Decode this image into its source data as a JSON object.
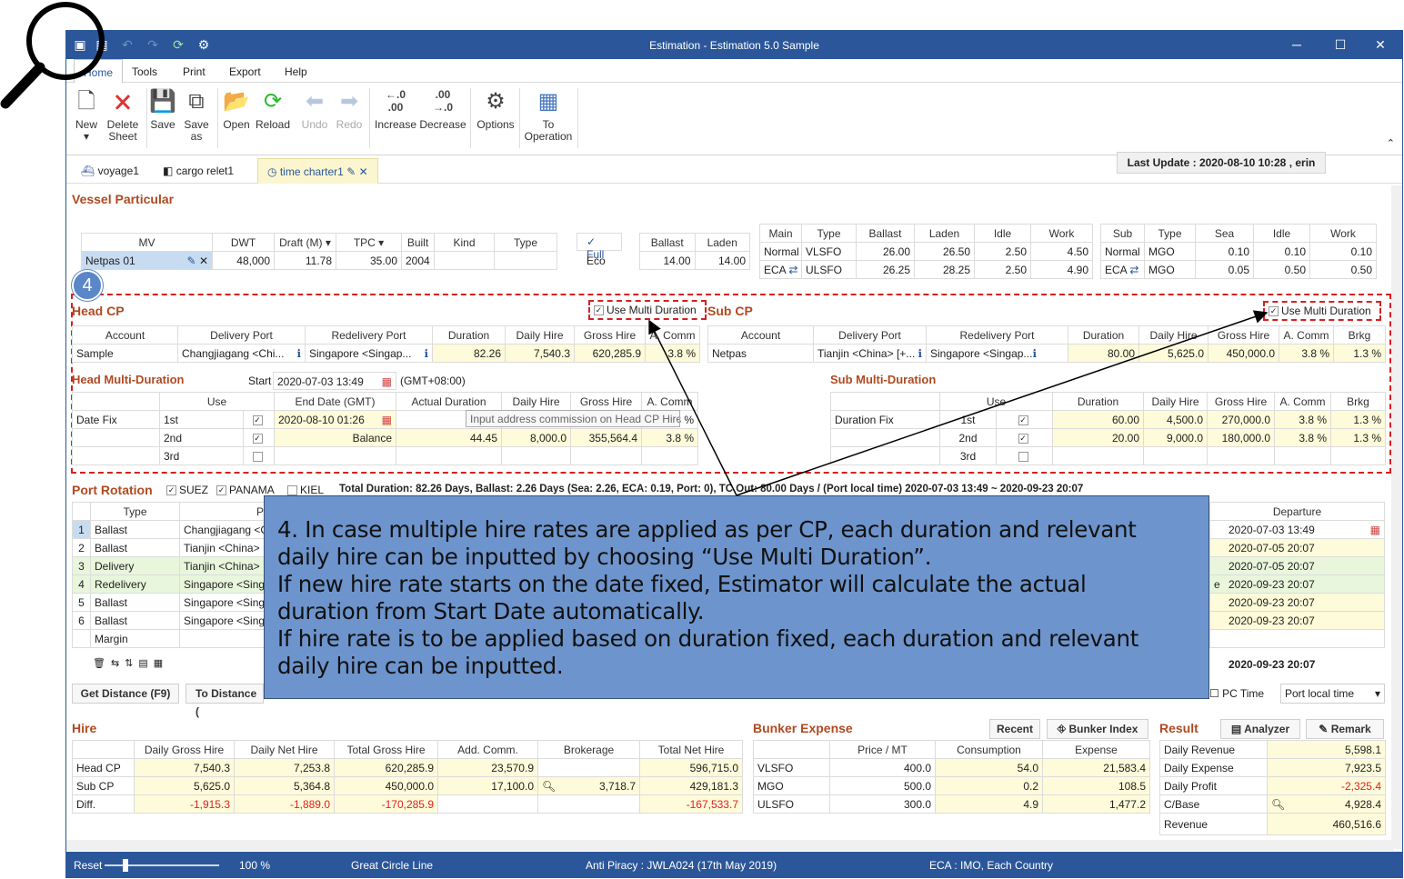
{
  "window": {
    "title": "Estimation - Estimation 5.0 Sample",
    "min": "─",
    "max": "☐",
    "close": "✕"
  },
  "menu": {
    "home": "Home",
    "tools": "Tools",
    "print": "Print",
    "export": "Export",
    "help": "Help"
  },
  "ribbon": {
    "new": "New",
    "delete": "Delete",
    "sheet": "Sheet",
    "save": "Save",
    "save_as1": "Save",
    "save_as2": "as",
    "open": "Open",
    "reload": "Reload",
    "undo": "Undo",
    "redo": "Redo",
    "increase": "Increase",
    "decrease": "Decrease",
    "options": "Options",
    "to_op1": "To",
    "to_op2": "Operation",
    "inc_top": "←.0",
    "inc_bot": ".00",
    "dec_top": ".00",
    "dec_bot": "→.0"
  },
  "tabs": [
    "voyage1",
    "cargo relet1",
    "time charter1"
  ],
  "vessel": {
    "title": "Vessel Particular",
    "last_update": "Last Update : 2020-08-10 10:28 , erin",
    "headers": [
      "MV",
      "DWT",
      "Draft (M)",
      "TPC",
      "Built",
      "Kind",
      "Type"
    ],
    "row": [
      "Netpas 01",
      "48,000",
      "11.78",
      "35.00",
      "2004",
      "",
      ""
    ],
    "full": "✓ Full",
    "eco": "Eco",
    "bl_headers": [
      "Ballast",
      "Laden"
    ],
    "bl_row": [
      "14.00",
      "14.00"
    ],
    "main_headers": [
      "Main",
      "Type",
      "Ballast",
      "Laden",
      "Idle",
      "Work"
    ],
    "main_rows": [
      [
        "Normal",
        "VLSFO",
        "26.00",
        "26.50",
        "2.50",
        "4.50"
      ],
      [
        "ECA",
        "ULSFO",
        "26.25",
        "28.25",
        "2.50",
        "4.90"
      ]
    ],
    "sub_headers": [
      "Sub",
      "Type",
      "Sea",
      "Idle",
      "Work"
    ],
    "sub_rows": [
      [
        "Normal",
        "MGO",
        "0.10",
        "0.10",
        "0.10"
      ],
      [
        "ECA",
        "MGO",
        "0.05",
        "0.50",
        "0.50"
      ]
    ]
  },
  "badge": "4",
  "head_cp": {
    "title": "Head CP",
    "use_multi": "Use Multi Duration",
    "headers": [
      "Account",
      "Delivery Port",
      "Redelivery Port",
      "Duration",
      "Daily Hire",
      "Gross Hire",
      "A. Comm"
    ],
    "row": [
      "Sample",
      "Changjiagang <Chi...",
      "Singapore <Singap...",
      "82.26",
      "7,540.3",
      "620,285.9",
      "3.8 %"
    ]
  },
  "sub_cp": {
    "title": "Sub CP",
    "use_multi": "Use Multi Duration",
    "headers": [
      "Account",
      "Delivery Port",
      "Redelivery Port",
      "Duration",
      "Daily Hire",
      "Gross Hire",
      "A. Comm",
      "Brkg"
    ],
    "row": [
      "Netpas",
      "Tianjin <China> [+...",
      "Singapore <Singap...",
      "80.00",
      "5,625.0",
      "450,000.0",
      "3.8 %",
      "1.3 %"
    ]
  },
  "head_md": {
    "title": "Head Multi-Duration",
    "start_label": "Start",
    "start": "2020-07-03 13:49",
    "tz": "(GMT+08:00)",
    "headers": [
      "Use",
      "End Date (GMT)",
      "Actual Duration",
      "Daily Hire",
      "Gross Hire",
      "A. Comm"
    ],
    "rows": [
      [
        "Date Fix",
        "1st",
        "2020-08-10 01:26",
        "",
        "",
        "",
        "3.8 %"
      ],
      [
        "",
        "2nd",
        "Balance",
        "44.45",
        "8,000.0",
        "355,564.4",
        "3.8 %"
      ],
      [
        "",
        "3rd",
        "",
        "",
        "",
        "",
        ""
      ]
    ],
    "tooltip": "Input address commission on Head CP Hire."
  },
  "sub_md": {
    "title": "Sub Multi-Duration",
    "headers": [
      "Use",
      "Duration",
      "Daily Hire",
      "Gross Hire",
      "A. Comm",
      "Brkg"
    ],
    "rows": [
      [
        "Duration Fix",
        "1st",
        "60.00",
        "4,500.0",
        "270,000.0",
        "3.8 %",
        "1.3 %"
      ],
      [
        "",
        "2nd",
        "20.00",
        "9,000.0",
        "180,000.0",
        "3.8 %",
        "1.3 %"
      ],
      [
        "",
        "3rd",
        "",
        "",
        "",
        "",
        ""
      ]
    ]
  },
  "port": {
    "title": "Port Rotation",
    "suez": "SUEZ",
    "panama": "PANAMA",
    "kiel": "KIEL",
    "summary": "Total Duration: 82.26 Days, Ballast: 2.26 Days (Sea: 2.26, ECA: 0.19, Port: 0), TC Out: 80.00 Days / (Port local time) 2020-07-03 13:49 ~ 2020-09-23 20:07",
    "type_header": "Type",
    "p_header": "P",
    "dep_header": "Departure",
    "rows": [
      [
        "1",
        "Ballast",
        "Changjiagang <C",
        "2020-07-03 13:49"
      ],
      [
        "2",
        "Ballast",
        "Tianjin <China>",
        "2020-07-05 20:07"
      ],
      [
        "3",
        "Delivery",
        "Tianjin <China>",
        "2020-07-05 20:07"
      ],
      [
        "4",
        "Redelivery",
        "Singapore <Sing",
        "2020-09-23 20:07"
      ],
      [
        "5",
        "Ballast",
        "Singapore <Sing",
        "2020-09-23 20:07"
      ],
      [
        "6",
        "Ballast",
        "Singapore <Sing",
        "2020-09-23 20:07"
      ]
    ],
    "margin": "Margin",
    "last_dep": "2020-09-23 20:07",
    "e_frag": "e",
    "get_distance": "Get Distance (F9)",
    "to_distance": "To Distance (",
    "pc_time": "PC Time",
    "port_local": "Port local time"
  },
  "callout": [
    "4.  In case multiple hire rates are applied as per CP, each duration and relevant",
    "daily hire can be inputted by choosing “Use Multi Duration”.",
    "If new hire rate starts on the date fixed, Estimator will calculate the actual",
    "duration from Start Date automatically.",
    "If hire rate is to be applied based on duration fixed, each duration and relevant",
    "daily hire can be inputted."
  ],
  "hire": {
    "title": "Hire",
    "headers": [
      "",
      "Daily Gross Hire",
      "Daily Net Hire",
      "Total Gross Hire",
      "Add. Comm.",
      "Brokerage",
      "Total Net Hire"
    ],
    "rows": [
      [
        "Head CP",
        "7,540.3",
        "7,253.8",
        "620,285.9",
        "23,570.9",
        "",
        "596,715.0"
      ],
      [
        "Sub CP",
        "5,625.0",
        "5,364.8",
        "450,000.0",
        "17,100.0",
        "3,718.7",
        "429,181.3"
      ],
      [
        "Diff.",
        "-1,915.3",
        "-1,889.0",
        "-170,285.9",
        "",
        "",
        "-167,533.7"
      ]
    ]
  },
  "bunker": {
    "title": "Bunker Expense",
    "recent": "Recent",
    "index": "Bunker Index",
    "headers": [
      "",
      "Price / MT",
      "Consumption",
      "Expense"
    ],
    "rows": [
      [
        "VLSFO",
        "400.0",
        "54.0",
        "21,583.4"
      ],
      [
        "MGO",
        "500.0",
        "0.2",
        "108.5"
      ],
      [
        "ULSFO",
        "300.0",
        "4.9",
        "1,477.2"
      ]
    ]
  },
  "result": {
    "title": "Result",
    "analyzer": "Analyzer",
    "remark": "Remark",
    "rows": [
      [
        "Daily Revenue",
        "5,598.1"
      ],
      [
        "Daily Expense",
        "7,923.5"
      ],
      [
        "Daily Profit",
        "-2,325.4"
      ],
      [
        "C/Base",
        "4,928.4"
      ],
      [
        "Revenue",
        "460,516.6"
      ]
    ]
  },
  "status": {
    "reset": "Reset",
    "zoom": "100 %",
    "gc": "Great Circle Line",
    "anti": "Anti Piracy : JWLA024 (17th May 2019)",
    "eca": "ECA : IMO, Each Country"
  }
}
